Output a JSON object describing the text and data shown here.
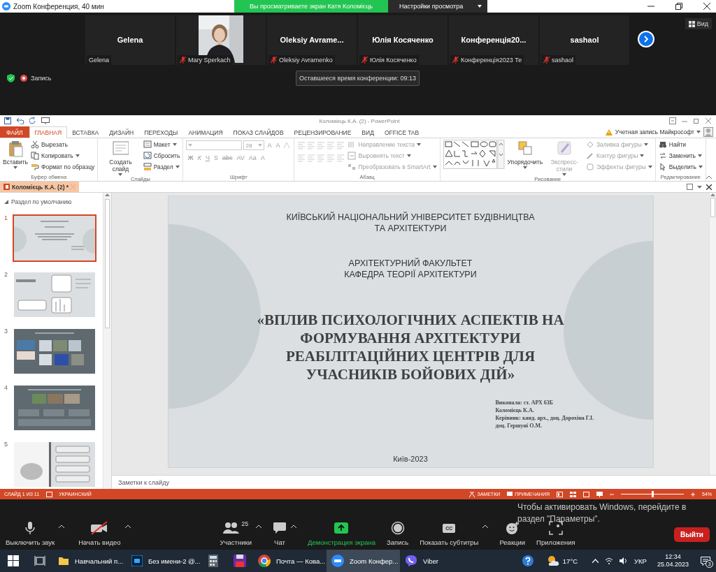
{
  "zoom_window": {
    "title": "Zoom Конференция, 40 мин"
  },
  "share_banner": {
    "message": "Вы просматриваете экран Катя Коломієць",
    "options": "Настройки просмотра"
  },
  "participants": [
    {
      "kind": "name",
      "name": "Gelena",
      "caption": "Gelena",
      "muted": false
    },
    {
      "kind": "video",
      "caption": "Mary Sperkach",
      "muted": true
    },
    {
      "kind": "name",
      "name": "Oleksiy Avrame...",
      "caption": "Oleksiy Avramenko",
      "muted": true
    },
    {
      "kind": "name",
      "name": "Юлія Косяченко",
      "caption": "Юлія Косяченко",
      "muted": true
    },
    {
      "kind": "name",
      "name": "Конференція20...",
      "caption": "Конференція2023 Те",
      "muted": true
    },
    {
      "kind": "name",
      "name": "sashaol",
      "caption": "sashaol",
      "muted": true
    }
  ],
  "view_button": "Вид",
  "recording_label": "Запись",
  "time_remaining": "Оставшееся время конференции: 09:13",
  "powerpoint": {
    "title": "Коломієць К.А. (2) - PowerPoint",
    "tabs": [
      {
        "kind": "file",
        "label": "ФАЙЛ",
        "selected": false
      },
      {
        "kind": "tab",
        "label": "ГЛАВНАЯ",
        "selected": true
      },
      {
        "kind": "tab",
        "label": "ВСТАВКА",
        "selected": false
      },
      {
        "kind": "tab",
        "label": "ДИЗАЙН",
        "selected": false
      },
      {
        "kind": "tab",
        "label": "ПЕРЕХОДЫ",
        "selected": false
      },
      {
        "kind": "tab",
        "label": "АНИМАЦИЯ",
        "selected": false
      },
      {
        "kind": "tab",
        "label": "ПОКАЗ СЛАЙДОВ",
        "selected": false
      },
      {
        "kind": "tab",
        "label": "РЕЦЕНЗИРОВАНИЕ",
        "selected": false
      },
      {
        "kind": "tab",
        "label": "ВИД",
        "selected": false
      },
      {
        "kind": "tab",
        "label": "OFFICE TAB",
        "selected": false
      }
    ],
    "account": "Учетная запись Майкрософт",
    "ribbon_groups": [
      {
        "label": "Буфер обмена",
        "columns": [
          [
            {
              "kind": "large",
              "label": "Вставить",
              "menu": true,
              "disabled": false
            }
          ],
          [
            {
              "kind": "small",
              "label": "Вырезать",
              "disabled": false
            },
            {
              "kind": "small",
              "label": "Копировать",
              "menu": true,
              "disabled": false
            },
            {
              "kind": "small",
              "label": "Формат по образцу",
              "disabled": false
            }
          ]
        ]
      },
      {
        "label": "Слайды",
        "columns": [
          [
            {
              "kind": "large",
              "label": "Создать слайд",
              "menu": true,
              "disabled": false
            }
          ],
          [
            {
              "kind": "small",
              "label": "Макет",
              "menu": true,
              "disabled": false
            },
            {
              "kind": "small",
              "label": "Сбросить",
              "disabled": false
            },
            {
              "kind": "small",
              "label": "Раздел",
              "menu": true,
              "disabled": false
            }
          ]
        ]
      },
      {
        "label": "Шрифт",
        "columns": [
          [
            {
              "kind": "row",
              "items": [
                {
                  "kind": "field",
                  "disabled": true
                },
                {
                  "kind": "field",
                  "value": "28",
                  "disabled": true
                },
                {
                  "kind": "glyph",
                  "label": "A",
                  "disabled": true
                },
                {
                  "kind": "glyph",
                  "label": "A",
                  "disabled": true
                },
                {
                  "kind": "icon",
                  "disabled": true
                }
              ]
            },
            {
              "kind": "row",
              "items": [
                {
                  "kind": "glyph",
                  "label": "Ж",
                  "disabled": true
                },
                {
                  "kind": "glyph",
                  "label": "К",
                  "disabled": true
                },
                {
                  "kind": "glyph",
                  "label": "Ч",
                  "disabled": true
                },
                {
                  "kind": "glyph",
                  "label": "S",
                  "disabled": true
                },
                {
                  "kind": "glyph",
                  "label": "abc",
                  "disabled": true
                },
                {
                  "kind": "glyph",
                  "label": "AV",
                  "disabled": true
                },
                {
                  "kind": "glyph",
                  "label": "Aa",
                  "disabled": true
                },
                {
                  "kind": "glyph",
                  "label": "A",
                  "disabled": true
                }
              ]
            }
          ]
        ]
      },
      {
        "label": "Абзац",
        "columns": [
          [
            {
              "kind": "row",
              "items": [
                {
                  "kind": "icon",
                  "disabled": true
                },
                {
                  "kind": "icon",
                  "disabled": true
                },
                {
                  "kind": "icon",
                  "disabled": true
                },
                {
                  "kind": "icon",
                  "disabled": true
                },
                {
                  "kind": "icon",
                  "disabled": true
                }
              ]
            },
            {
              "kind": "row",
              "items": [
                {
                  "kind": "icon",
                  "disabled": true
                },
                {
                  "kind": "icon",
                  "disabled": true
                },
                {
                  "kind": "icon",
                  "disabled": true
                },
                {
                  "kind": "icon",
                  "disabled": true
                },
                {
                  "kind": "icon",
                  "disabled": true
                }
              ]
            }
          ],
          [
            {
              "kind": "small",
              "label": "Направление текста",
              "menu": true,
              "disabled": true
            },
            {
              "kind": "small",
              "label": "Выровнять текст",
              "menu": true,
              "disabled": true
            },
            {
              "kind": "small",
              "label": "Преобразовать в SmartArt",
              "menu": true,
              "disabled": true
            }
          ]
        ]
      },
      {
        "label": "Рисование",
        "columns": [
          [
            {
              "kind": "gallery"
            }
          ],
          [
            {
              "kind": "large",
              "label": "Упорядочить",
              "menu": true,
              "disabled": false
            }
          ],
          [
            {
              "kind": "large",
              "label": "Экспресс-стили",
              "menu": true,
              "disabled": true
            }
          ],
          [
            {
              "kind": "small",
              "label": "Заливка фигуры",
              "menu": true,
              "disabled": true
            },
            {
              "kind": "small",
              "label": "Контур фигуры",
              "menu": true,
              "disabled": true
            },
            {
              "kind": "small",
              "label": "Эффекты фигуры",
              "menu": true,
              "disabled": true
            }
          ]
        ]
      },
      {
        "label": "Редактирование",
        "columns": [
          [
            {
              "kind": "small",
              "label": "Найти",
              "disabled": false
            },
            {
              "kind": "small",
              "label": "Заменить",
              "menu": true,
              "disabled": false
            },
            {
              "kind": "small",
              "label": "Выделить",
              "menu": true,
              "disabled": false
            }
          ]
        ]
      }
    ],
    "document_tab": "Коломієць К.А. (2) *",
    "section": "Раздел по умолчанию",
    "thumbnails": [
      {
        "number": "1",
        "kind": "title",
        "selected": true
      },
      {
        "number": "2",
        "kind": "table",
        "selected": false
      },
      {
        "number": "3",
        "kind": "gallery",
        "selected": false
      },
      {
        "number": "4",
        "kind": "cards",
        "selected": false
      },
      {
        "number": "5",
        "kind": "diagram",
        "selected": false
      }
    ],
    "slide": {
      "university": [
        "КИЇВСЬКИЙ НАЦІОНАЛЬНИЙ УНІВЕРСИТЕТ БУДІВНИЦТВА",
        "ТА АРХІТЕКТУРИ"
      ],
      "department": [
        "АРХІТЕКТУРНИЙ ФАКУЛЬТЕТ",
        "КАФЕДРА ТЕОРІЇ АРХІТЕКТУРИ"
      ],
      "title": [
        "«ВПЛИВ ПСИХОЛОГІЧНИХ АСПЕКТІВ НА",
        "ФОРМУВАННЯ АРХІТЕКТУРИ",
        "РЕАБІЛІТАЦІЙНИХ ЦЕНТРІВ ДЛЯ",
        "УЧАСНИКІВ БОЙОВИХ ДІЙ»"
      ],
      "credits": [
        "Виконала: ст. АРХ 63Б",
        "Коломієць К.А.",
        "Керівник: канд. арх., доц. Дорохіна Г.І.",
        "доц. Гершуні О.М."
      ],
      "footer": "Київ-2023"
    },
    "notes_placeholder": "Заметки к слайду",
    "status_bar": {
      "slide": "СЛАЙД 1 ИЗ 11",
      "language": "УКРАИНСКИЙ",
      "notes": "ЗАМЕТКИ",
      "comments": "ПРИМЕЧАНИЯ",
      "zoom": "54%",
      "zoom_slider": {
        "level": 0.5
      }
    }
  },
  "activation_notice": "Чтобы активировать Windows, перейдите в раздел \"Параметры\".",
  "meeting_controls": [
    {
      "kind": "mic",
      "label": "Выключить звук",
      "menu": true
    },
    {
      "kind": "video",
      "label": "Начать видео",
      "menu": true
    },
    {
      "kind": "participants",
      "label": "Участники",
      "count": "25",
      "menu": true
    },
    {
      "kind": "chat",
      "label": "Чат",
      "menu": true
    },
    {
      "kind": "share",
      "label": "Демонстрация экрана"
    },
    {
      "kind": "record",
      "label": "Запись"
    },
    {
      "kind": "cc",
      "label": "Показать субтитры",
      "badge": "CC",
      "menu": true
    },
    {
      "kind": "reactions",
      "label": "Реакции"
    },
    {
      "kind": "apps",
      "label": "Приложения"
    }
  ],
  "leave_button": "Выйти",
  "taskbar": {
    "items": [
      {
        "kind": "start",
        "selected": false
      },
      {
        "kind": "taskview",
        "selected": false
      },
      {
        "kind": "folder",
        "label": "Навчальний п...",
        "selected": false
      },
      {
        "kind": "editor",
        "label": "Без имени-2 @...",
        "selected": false
      },
      {
        "kind": "calculator",
        "selected": false
      },
      {
        "kind": "disk",
        "selected": false
      },
      {
        "kind": "browser",
        "label": "Почта — Кова...",
        "selected": false
      },
      {
        "kind": "meeting",
        "label": "Zoom Конфер...",
        "selected": true
      },
      {
        "kind": "messenger",
        "label": "Viber",
        "selected": false
      }
    ],
    "temperature": "17°C",
    "language": "УКР",
    "time": "12:34",
    "date": "25.04.2023",
    "notifications": "3"
  }
}
